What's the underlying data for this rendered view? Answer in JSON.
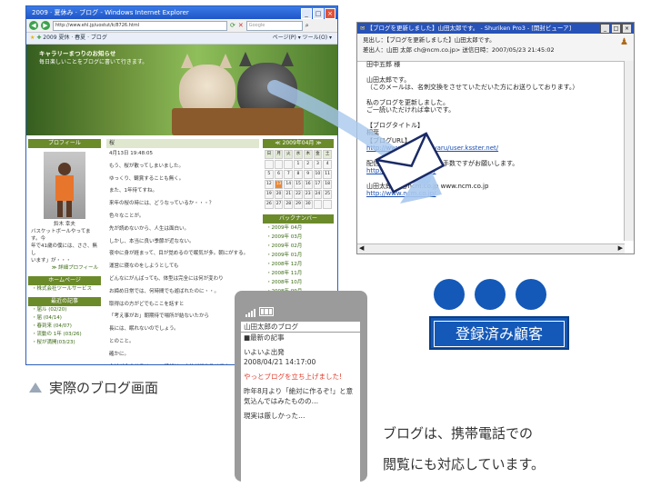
{
  "browser": {
    "window_title": "2009 · 夏休み · ブログ - Windows Internet Explorer",
    "address": "http://www.ehl.jp/uostut/k/8726.html",
    "search_placeholder": "Google",
    "fav_tab": "2009 夏休 · 春夏 · ブログ",
    "tools": "ページ(P) ▾ ツール(O) ▾",
    "banner_line1": "キャラリーまつりのお知らせ",
    "banner_line2": "毎日楽しいことをブログに書いて行きます。",
    "left_header": "プロフィール",
    "profile_name": "鈴木 幸夫",
    "profile_text": [
      "バスケットボールやってます。今",
      "年で41歳の僕には、ささ、無し",
      "います」が・・・"
    ],
    "profile_more": "≫ 詳細プロフィール",
    "homepage_header": "ホームページ",
    "homepage_link": "・株式会社ツールサービス",
    "recent_header": "最近の記事",
    "recent_links": [
      "・届ル (02/20)",
      "・届 (04/14)",
      "・春到来 (04/07)",
      "・流動の 1年 (03/26)",
      "・桜が満開(03/23)"
    ],
    "post_header": "桜",
    "post_date": "4月13日   19:48:05",
    "post_lines": [
      "もう、桜が散ってしまいました。",
      "ゆっくり、観賞することも無く。",
      "また、1年待てすね。",
      "来年の桜の時には、どうなっているか・・・？",
      "色々なことが。",
      "先が読めないから、人生は面白い。",
      "",
      "しかし、本当に良い季節が近なない。",
      "夜中に身が経まって、目が覚めるので眠気が多。朝にがする。",
      "運営に寝なのをしようとしても",
      "どんなにがんばっても、体型は完全には何が変わり",
      "お締め日常では、何時間でも遊ばれたのに・・。",
      "取得はの方がどでもここを話すと",
      "「考え事がお」朝期待で場所が結ないたから",
      "長には、眠れないのでしょう。",
      "とのこと。",
      "確かに。",
      "会社が今のサラリーマン時代は、大体が繰り性せです"
    ],
    "calendar_title": "≪ 2009年04月 ≫",
    "calendar_days": [
      "日",
      "月",
      "火",
      "水",
      "木",
      "金",
      "土"
    ],
    "calendar_dates": [
      "",
      "",
      "",
      "1",
      "2",
      "3",
      "4",
      "5",
      "6",
      "7",
      "8",
      "9",
      "10",
      "11",
      "12",
      "13",
      "14",
      "15",
      "16",
      "17",
      "18",
      "19",
      "20",
      "21",
      "22",
      "23",
      "24",
      "25",
      "26",
      "27",
      "28",
      "29",
      "30",
      "",
      ""
    ],
    "backnumber_header": "バックナンバー",
    "backnumbers": [
      "・2009年 04月",
      "・2009年 03月",
      "・2009年 02月",
      "・2009年 01月",
      "・2008年 12月",
      "・2008年 11月",
      "・2008年 10月",
      "・2008年 09月"
    ]
  },
  "mail": {
    "title": "【ブログを更新しました】山田太郎です。 - Shuriken Pro3 - [開封ビューア]",
    "subject_line": "見出し：【ブログを更新しました】山田太郎です。",
    "from_line": "差出人：山田 太郎      ch@ncm.co.jp>     送信日時：2007/05/23 21:45:02",
    "body": [
      {
        "text": "田中五郎 様",
        "link": false
      },
      {
        "text": "",
        "link": false
      },
      {
        "text": "山田太郎です。",
        "link": false
      },
      {
        "text": "（このメールは、名刺交換をさせていただいた方にお送りしております。）",
        "link": false
      },
      {
        "text": "",
        "link": false
      },
      {
        "text": "私のブログを更新しました。",
        "link": false
      },
      {
        "text": "ご一読いただければ幸いです。",
        "link": false
      },
      {
        "text": "",
        "link": false
      },
      {
        "text": "【ブログタイトル】",
        "link": false
      },
      {
        "text": "桐葉",
        "link": false
      },
      {
        "text": "【ブログURL】",
        "link": false
      },
      {
        "text": "http://www.ehl.jp/ossyaru/user.ksster.net/",
        "link": true
      },
      {
        "text": "",
        "link": false
      },
      {
        "text": "配信停止をご希望の方はお手数ですがお願いします。",
        "link": false
      },
      {
        "text": "http://www.ncm.co.jp/",
        "link": true
      },
      {
        "text": "",
        "link": false
      },
      {
        "text": "山田太郎 ch@ncm.co.jp www.ncm.co.jp",
        "link": false
      },
      {
        "text": "http://www.ncm.co.jp/",
        "link": true
      }
    ]
  },
  "customers_label": "登録済み顧客",
  "phone": {
    "lines": [
      {
        "text": "山田太郎のブログ",
        "red": false
      },
      {
        "text": "■最新の記事",
        "red": false
      },
      {
        "text": "",
        "red": false
      },
      {
        "text": "いよいよ出発",
        "red": false
      },
      {
        "text": "2008/04/21  14:17:00",
        "red": false
      },
      {
        "text": "",
        "red": false
      },
      {
        "text": "やっとブログを立ち上げました!",
        "red": true
      },
      {
        "text": "",
        "red": false
      },
      {
        "text": "昨年8月より「絶対に作るぞ!」と意",
        "red": false
      },
      {
        "text": "気込んではみたものの…",
        "red": false
      },
      {
        "text": "",
        "red": false
      },
      {
        "text": "現実は厳しかった…",
        "red": false
      }
    ]
  },
  "captions": {
    "blog_caption": "実際のブログ画面",
    "mobile_line1": "ブログは、携帯電話での",
    "mobile_line2": "閲覧にも対応しています。"
  },
  "colors": {
    "ie_title": "#1f55c7",
    "blog_green": "#6b8a2a",
    "mail_title": "#2752b8",
    "customer_blue": "#1459b8",
    "phone_red": "#e03c2c",
    "arrow": "#a8c8ee"
  }
}
